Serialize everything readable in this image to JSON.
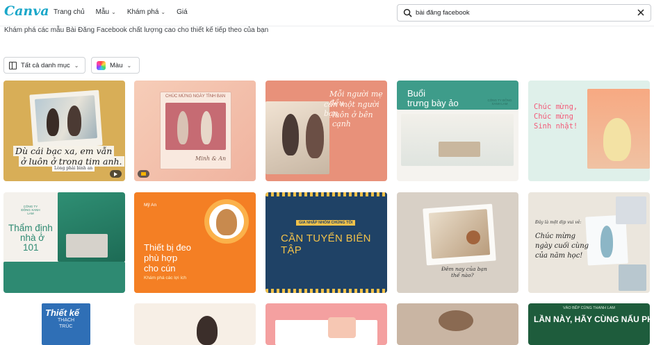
{
  "brand": {
    "logo": "Canva",
    "accent": "#1aa7c9"
  },
  "nav": {
    "items": [
      {
        "label": "Trang chủ",
        "has_dropdown": false
      },
      {
        "label": "Mẫu",
        "has_dropdown": true
      },
      {
        "label": "Khám phá",
        "has_dropdown": true
      },
      {
        "label": "Giá",
        "has_dropdown": false
      }
    ]
  },
  "search": {
    "value": "bài đăng facebook",
    "placeholder": ""
  },
  "subtitle": "Khám phá các mẫu Bài Đăng Facebook chất lượng cao cho thiết kế tiếp theo của bạn",
  "filters": {
    "category_label": "Tất cả danh mục",
    "color_label": "Màu"
  },
  "cards": [
    {
      "line1": "Dù cái bạc xa, em vẫn",
      "line2": "ở luôn ở trong tim anh.",
      "tag": "Lòng phải bình an",
      "bg": "#d8ae57"
    },
    {
      "banner": "CHÚC MỪNG NGÀY TÌNH BẠN",
      "names": "Minh & An",
      "bg": "#f4c4b0"
    },
    {
      "line1": "Mỗi người mẹ đều",
      "line2": "cần một người bạn",
      "line3": "luôn ở bên cạnh",
      "bg": "#e8917a"
    },
    {
      "line1": "Buổi",
      "line2": "trưng bày ảo",
      "company": "CÔNG TY ĐỒNG XANH LAM",
      "bg": "#3e9c8a"
    },
    {
      "line1": "Chúc mừng,",
      "line2": "Chúc mừng",
      "line3": "Sinh nhật!",
      "bg": "#dff0ea"
    },
    {
      "company": "CÔNG TY ĐỒNG XANH LAM",
      "line1": "Thẩm định",
      "line2": "nhà ở",
      "line3": "101",
      "bg": "#2e8a72"
    },
    {
      "brand": "Mỹ An",
      "line1": "Thiết bị đeo",
      "line2": "phù hợp",
      "line3": "cho cún",
      "link": "Khám phá các lợi ích",
      "bg": "#f47f24"
    },
    {
      "banner": "GIA NHẬP NHÓM CHÚNG TÔI",
      "title": "CẦN TUYỂN BIÊN TẬP",
      "bg": "#1f4266"
    },
    {
      "line1": "Đêm nay của bạn",
      "line2": "thế nào?",
      "bg": "#d8d0c6"
    },
    {
      "line1": "Đây là một dịp vui vẻ:",
      "line2": "Chúc mừng",
      "line3": "ngày cuối cùng",
      "line4": "của năm học!",
      "bg": "#ebe6dd"
    },
    {
      "line1": "Thiết kế",
      "line2": "THẠCH",
      "line3": "TRÚC",
      "bg": "#2f6fb6"
    },
    {
      "bg": "#f7efe6"
    },
    {
      "bg": "#f4a0a0"
    },
    {
      "bg": "#c9b5a3"
    },
    {
      "top": "VÀO BẾP CÙNG THANH LAM",
      "title": "LẦN NÀY, HÃY CÙNG NẤU PHỞ",
      "bg": "#1e5c3c"
    }
  ]
}
